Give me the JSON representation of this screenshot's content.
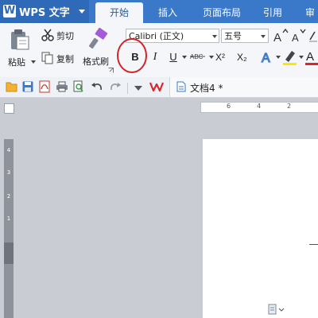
{
  "app": {
    "name": "WPS 文字",
    "logo_letter": "W"
  },
  "tabs": [
    {
      "label": "开始",
      "active": true
    },
    {
      "label": "插入"
    },
    {
      "label": "页面布局"
    },
    {
      "label": "引用"
    },
    {
      "label": "审"
    }
  ],
  "clipboard": {
    "paste": "粘贴",
    "cut": "剪切",
    "copy": "复制",
    "format_painter": "格式刷"
  },
  "font": {
    "name": "Calibri (正文)",
    "size": "五号"
  },
  "format_buttons": {
    "bold": "B",
    "italic": "I",
    "underline": "U",
    "superscript": "X²",
    "subscript": "X₂"
  },
  "document": {
    "tab_title": "文档4 *"
  },
  "ruler": {
    "h_ticks": [
      "6",
      "4",
      "2"
    ],
    "v_ticks": [
      "4",
      "3",
      "2",
      "1"
    ]
  },
  "colors": {
    "accent": "#3a78c9",
    "highlight_circle": "#d2232a",
    "wps_red": "#d9262b"
  }
}
